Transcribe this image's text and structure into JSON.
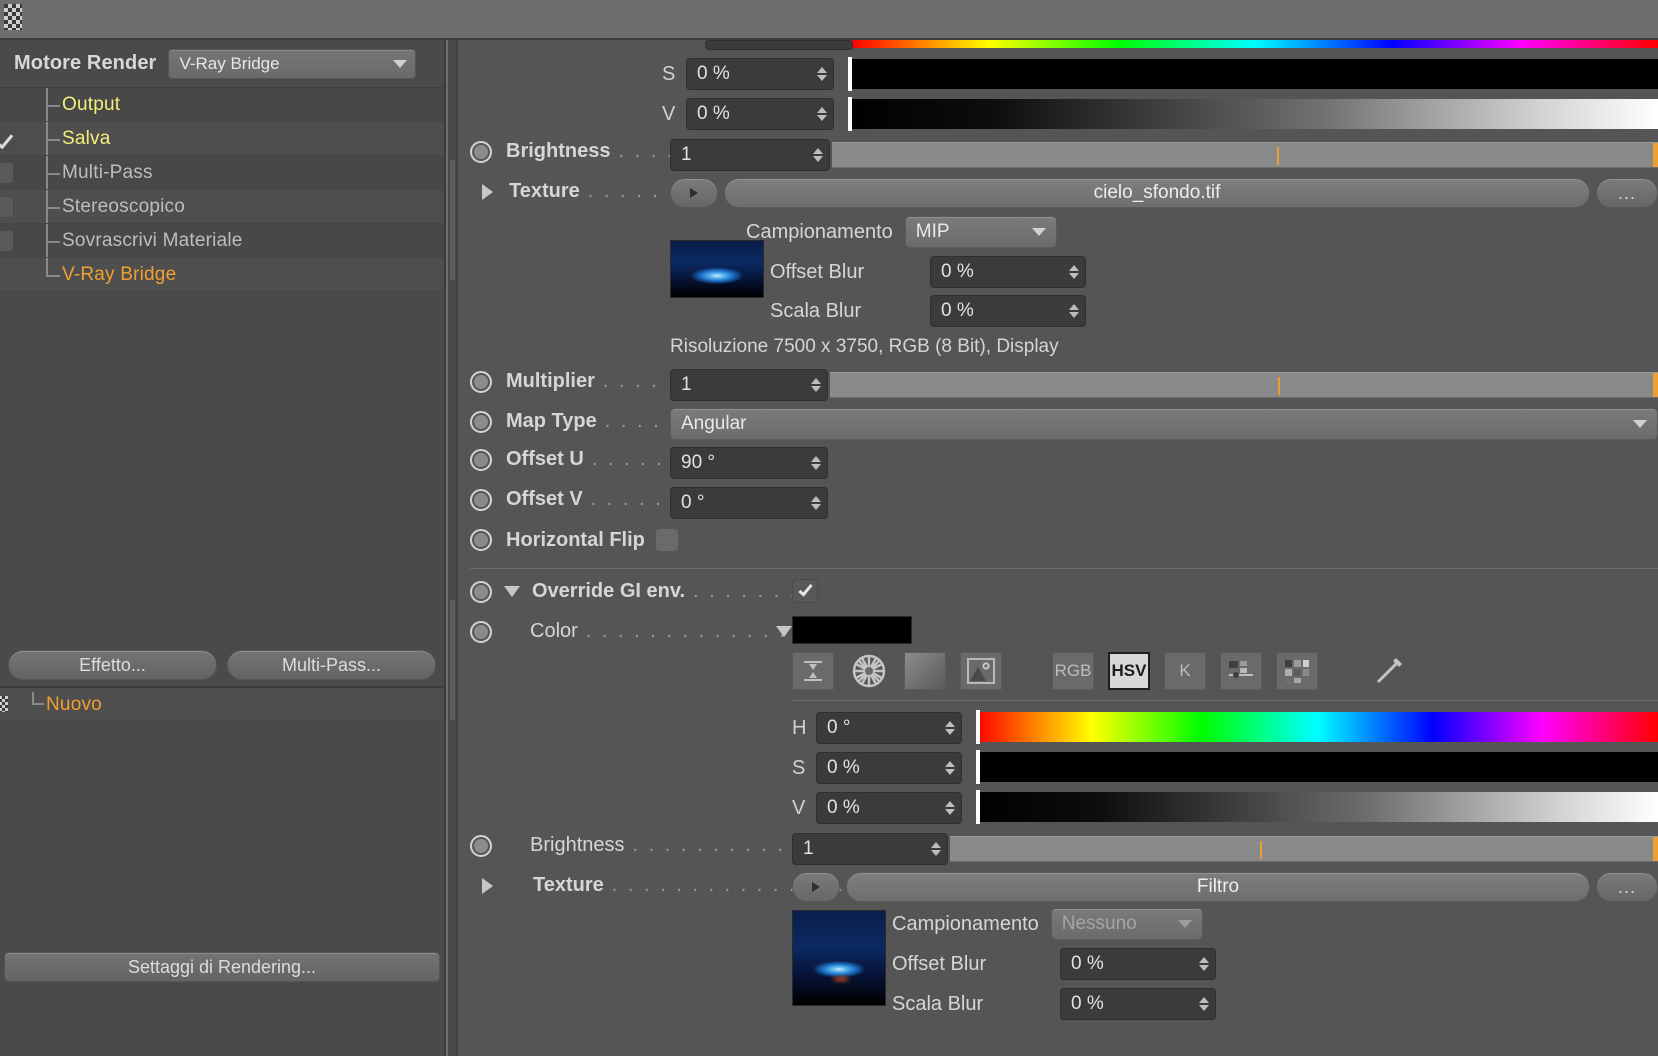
{
  "window": {
    "title_bar_icon": "drag-grip"
  },
  "left_panel": {
    "engine": {
      "label": "Motore Render",
      "selected": "V-Ray Bridge",
      "caret_icon": "chevron-down-icon"
    },
    "tree_items": [
      {
        "label": "Output",
        "color": "yellow",
        "checkbox": "none",
        "last": false
      },
      {
        "label": "Salva",
        "color": "yellow",
        "checkbox": "checked",
        "last": false
      },
      {
        "label": "Multi-Pass",
        "color": "grey",
        "checkbox": "unchecked",
        "last": false
      },
      {
        "label": "Stereoscopico",
        "color": "grey",
        "checkbox": "unchecked",
        "last": false
      },
      {
        "label": "Sovrascrivi Materiale",
        "color": "grey",
        "checkbox": "unchecked",
        "last": false
      },
      {
        "label": "V-Ray Bridge",
        "color": "orange",
        "checkbox": "none",
        "last": true
      }
    ],
    "buttons": {
      "effetto": "Effetto...",
      "multipass": "Multi-Pass...",
      "settaggi": "Settaggi di Rendering..."
    },
    "post_item": {
      "label": "Nuovo",
      "color": "orange"
    }
  },
  "main": {
    "top_color": {
      "s": {
        "label": "S",
        "value": "0 %"
      },
      "v": {
        "label": "V",
        "value": "0 %"
      }
    },
    "brightness_top": {
      "label": "Brightness",
      "dots": ". . . .",
      "value": "1"
    },
    "texture_top": {
      "label": "Texture",
      "dots": ". . . . . . .",
      "expand_icon": "triangle-right-icon",
      "link_icon": "play-icon",
      "filename": "cielo_sfondo.tif",
      "more_label": "..."
    },
    "sampling_top": {
      "campionamento_label": "Campionamento",
      "campionamento_value": "MIP",
      "offset_blur_label": "Offset Blur",
      "offset_blur_value": "0 %",
      "scala_blur_label": "Scala Blur",
      "scala_blur_value": "0 %",
      "resolution_info": "Risoluzione 7500 x 3750, RGB (8 Bit), Display"
    },
    "params": [
      {
        "name": "multiplier",
        "label": "Multiplier",
        "dots": ". . . .",
        "value": "1",
        "kind": "number-slider"
      },
      {
        "name": "map-type",
        "label": "Map Type",
        "dots": ". . . .",
        "value": "Angular",
        "kind": "combo"
      },
      {
        "name": "offset-u",
        "label": "Offset U",
        "dots": ". . . . .",
        "value": "90 °",
        "kind": "number"
      },
      {
        "name": "offset-v",
        "label": "Offset V",
        "dots": ". . . . . .",
        "value": "0 °",
        "kind": "number"
      },
      {
        "name": "horizontal-flip",
        "label": "Horizontal Flip",
        "dots": "",
        "value": "",
        "kind": "checkbox"
      }
    ],
    "override_gi": {
      "label": "Override GI env.",
      "dots": ". . . . . . . .",
      "checked": true,
      "expand_icon": "triangle-down-icon"
    },
    "color_row": {
      "label": "Color",
      "dots": ". . . . . . . . . . . . . .",
      "caret_icon": "triangle-down-icon",
      "swatch_hex": "#000000"
    },
    "picker_tools": [
      {
        "name": "eyedrop-target-icon",
        "glyph": "target",
        "active": false
      },
      {
        "name": "color-wheel-icon",
        "glyph": "wheel",
        "active": false
      },
      {
        "name": "gradient-icon",
        "glyph": "grad",
        "active": false
      },
      {
        "name": "image-picker-icon",
        "glyph": "image",
        "active": false
      },
      {
        "name": "rgb-mode-button",
        "glyph": "RGB",
        "active": false
      },
      {
        "name": "hsv-mode-button",
        "glyph": "HSV",
        "active": true
      },
      {
        "name": "kelvin-mode-button",
        "glyph": "K",
        "active": false
      },
      {
        "name": "mixer-icon",
        "glyph": "mixer",
        "active": false
      },
      {
        "name": "swatches-icon",
        "glyph": "swatch",
        "active": false
      },
      {
        "name": "pipette-icon",
        "glyph": "pipette",
        "active": false
      }
    ],
    "hsv": {
      "h": {
        "label": "H",
        "value": "0 °"
      },
      "s": {
        "label": "S",
        "value": "0 %"
      },
      "v": {
        "label": "V",
        "value": "0 %"
      }
    },
    "brightness_bottom": {
      "label": "Brightness",
      "dots": ". . . . . . . . . . . . .",
      "value": "1"
    },
    "texture_bottom": {
      "label": "Texture",
      "dots": ". . . . . . . . . . . . . . .",
      "expand_icon": "triangle-right-icon",
      "link_icon": "play-icon",
      "filename": "Filtro",
      "more_label": "..."
    },
    "sampling_bottom": {
      "campionamento_label": "Campionamento",
      "campionamento_value": "Nessuno",
      "offset_blur_label": "Offset Blur",
      "offset_blur_value": "0 %",
      "scala_blur_label": "Scala Blur",
      "scala_blur_value": "0 %"
    }
  },
  "colors": {
    "accent_orange": "#f0a030",
    "label_yellow": "#f2ef7a",
    "panel_bg": "#555555",
    "sidebar_bg": "#4a4a4a"
  }
}
